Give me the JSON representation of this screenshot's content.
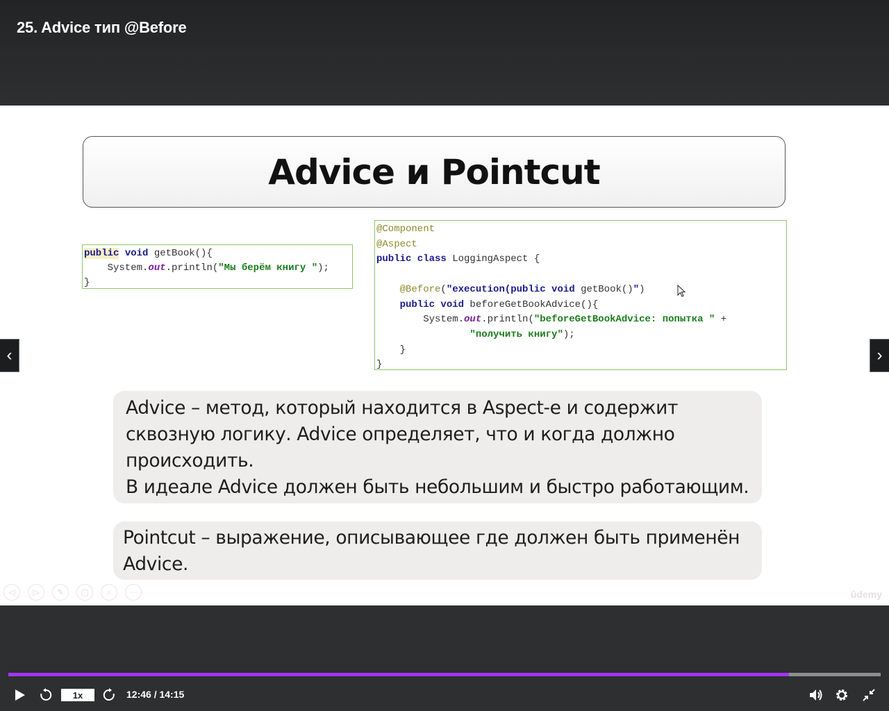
{
  "header": {
    "lecture_title": "25. Advice тип @Before"
  },
  "slide": {
    "title": "Advice и Pointcut",
    "code_left": {
      "line1_kw": "public",
      "line1_void": "void",
      "line1_rest": " getBook(){",
      "line2_a": "    System.",
      "line2_field": "out",
      "line2_b": ".println(",
      "line2_str": "\"Мы берём книгу \"",
      "line2_end": ");",
      "line3": "}"
    },
    "code_right": {
      "l1": "@Component",
      "l2": "@Aspect",
      "l3_kw": "public class",
      "l3_rest": " LoggingAspect {",
      "l5_ann": "    @Before",
      "l5_paren": "(",
      "l5_str_a": "\"execution(public void",
      "l5_str_b": " getBook()",
      "l5_str_c": "\"",
      "l5_end": ")",
      "l6_kw": "    public void",
      "l6_rest": " beforeGetBookAdvice(){",
      "l7_a": "        System.",
      "l7_field": "out",
      "l7_b": ".println(",
      "l7_str": "\"beforeGetBookAdvice: попытка \"",
      "l7_plus": " +",
      "l8_str": "                \"получить книгу\"",
      "l8_end": ");",
      "l9": "    }",
      "l10": "}"
    },
    "advice_text_l1": "Advice – метод, который находится в Aspect-е и содержит",
    "advice_text_l2": "сквозную логику. Advice определяет, что и когда должно",
    "advice_text_l3": "происходить.",
    "advice_text_l4": "В идеале Advice должен быть небольшим и быстро работающим.",
    "pointcut_text_l1": "Pointcut – выражение, описывающее где должен быть применён",
    "pointcut_text_l2": "Advice.",
    "watermark": "ûdemy"
  },
  "player": {
    "speed": "1x",
    "time": "12:46 / 14:15",
    "progress_fraction": 0.895,
    "accent_color": "#a435f0",
    "icons": [
      "play-icon",
      "rewind-icon",
      "forward-icon",
      "volume-icon",
      "settings-icon",
      "exit-fullscreen-icon",
      "chevron-left-icon",
      "chevron-right-icon"
    ]
  }
}
